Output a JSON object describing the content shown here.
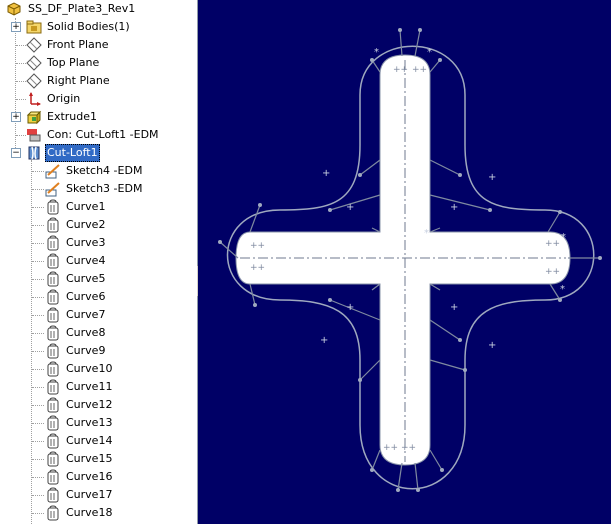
{
  "feature_tree": {
    "part_name": "SS_DF_Plate3_Rev1",
    "solid_bodies": "Solid Bodies(1)",
    "front_plane": "Front Plane",
    "top_plane": "Top Plane",
    "right_plane": "Right Plane",
    "origin": "Origin",
    "extrude": "Extrude1",
    "connector": "Con: Cut-Loft1 -EDM",
    "cut_loft": "Cut-Loft1",
    "sketches": [
      "Sketch4 -EDM",
      "Sketch3 -EDM"
    ],
    "curves": [
      "Curve1",
      "Curve2",
      "Curve3",
      "Curve4",
      "Curve5",
      "Curve6",
      "Curve7",
      "Curve8",
      "Curve9",
      "Curve10",
      "Curve11",
      "Curve12",
      "Curve13",
      "Curve14",
      "Curve15",
      "Curve16",
      "Curve17",
      "Curve18"
    ]
  },
  "colors": {
    "viewport_bg": "#000066",
    "selection": "#316ac5",
    "part_fill": "#ffffff",
    "profile_line": "#9fa9bf"
  },
  "icons": {
    "part": "part-icon",
    "folder": "folder-icon",
    "plane": "plane-icon",
    "origin": "origin-icon",
    "extrude": "extrude-icon",
    "connector": "connector-icon",
    "cut_loft": "cut-loft-icon",
    "sketch": "sketch-icon",
    "curve": "curve-icon"
  }
}
